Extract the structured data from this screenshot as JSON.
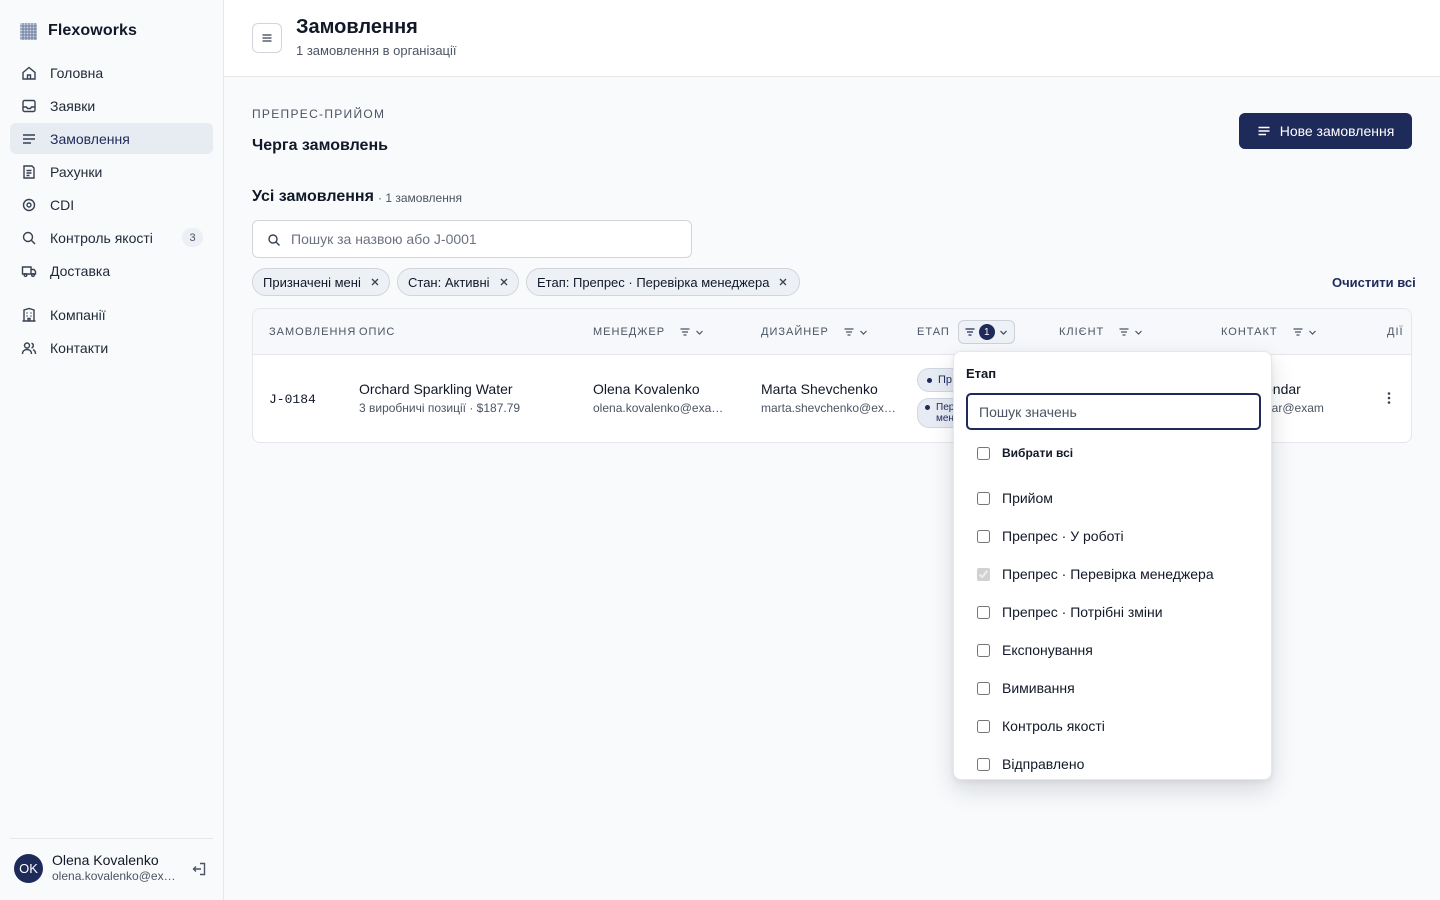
{
  "app": {
    "name": "Flexoworks"
  },
  "sidebar": {
    "items": [
      {
        "label": "Головна",
        "icon": "home-icon",
        "active": false
      },
      {
        "label": "Заявки",
        "icon": "inbox-icon",
        "active": false
      },
      {
        "label": "Замовлення",
        "icon": "list-icon",
        "active": true
      },
      {
        "label": "Рахунки",
        "icon": "invoice-icon",
        "active": false
      },
      {
        "label": "CDI",
        "icon": "target-icon",
        "active": false
      },
      {
        "label": "Контроль якості",
        "icon": "search-icon",
        "active": false,
        "badge": "3"
      },
      {
        "label": "Доставка",
        "icon": "truck-icon",
        "active": false
      }
    ],
    "secondary": [
      {
        "label": "Компанії",
        "icon": "building-icon"
      },
      {
        "label": "Контакти",
        "icon": "users-icon"
      }
    ],
    "user": {
      "initials": "OK",
      "name": "Olena Kovalenko",
      "email": "olena.kovalenko@example.com"
    }
  },
  "header": {
    "title": "Замовлення",
    "subtitle": "1 замовлення в організації"
  },
  "main": {
    "eyebrow": "ПРЕПРЕС-ПРИЙОМ",
    "section_title": "Черга замовлень",
    "new_button": "Нове замовлення",
    "list_title": "Усі замовлення",
    "list_count": "· 1 замовлення",
    "search_placeholder": "Пошук за назвою або J-0001",
    "filters": [
      "Призначені мені",
      "Стан: Активні",
      "Етап: Препрес · Перевірка менеджера"
    ],
    "clear_all": "Очистити всі"
  },
  "table": {
    "columns": {
      "order": "ЗАМОВЛЕННЯ",
      "desc": "ОПИС",
      "manager": "МЕНЕДЖЕР",
      "designer": "ДИЗАЙНЕР",
      "stage": "ЕТАП",
      "stage_filter_count": "1",
      "client": "КЛІЄНТ",
      "contact": "КОНТАКТ",
      "actions": "ДІЇ"
    },
    "rows": [
      {
        "id": "J-0184",
        "title": "Orchard Sparkling Water",
        "details": "3 виробничі позиції · $187.79",
        "manager_name": "Olena Kovalenko",
        "manager_email": "olena.kovalenko@example.com",
        "designer_name": "Marta Shevchenko",
        "designer_email": "marta.shevchenko@example.com",
        "stage_1": "Пр",
        "stage_2a": "Пер",
        "stage_2b": "мен",
        "contact_name": "ondar",
        "contact_email": "dar@exam"
      }
    ]
  },
  "popover": {
    "title": "Етап",
    "search_placeholder": "Пошук значень",
    "select_all": "Вибрати всі",
    "options": [
      {
        "label": "Прийом",
        "checked": false
      },
      {
        "label": "Препрес · У роботі",
        "checked": false
      },
      {
        "label": "Препрес · Перевірка менеджера",
        "checked": true
      },
      {
        "label": "Препрес · Потрібні зміни",
        "checked": false
      },
      {
        "label": "Експонування",
        "checked": false
      },
      {
        "label": "Вимивання",
        "checked": false
      },
      {
        "label": "Контроль якості",
        "checked": false
      },
      {
        "label": "Відправлено",
        "checked": false
      }
    ]
  },
  "colors": {
    "accent": "#1e2a5a",
    "background": "#f8fafc"
  }
}
